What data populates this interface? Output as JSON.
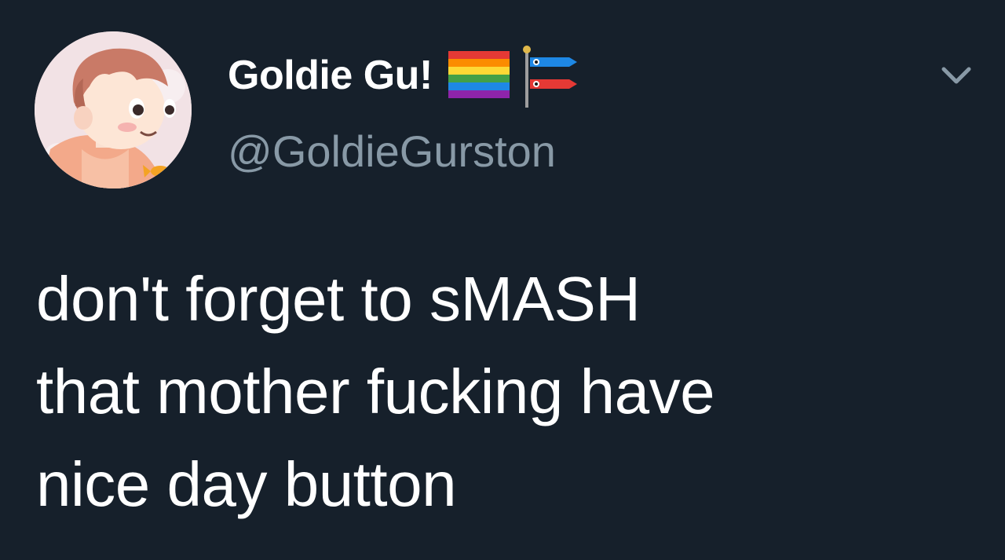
{
  "author": {
    "display_name": "Goldie Gu!",
    "handle": "@GoldieGurston",
    "avatar_icon": "cartoon-boy-avatar",
    "name_emojis": [
      "rainbow-flag-icon",
      "carp-streamer-icon"
    ]
  },
  "tweet": {
    "lines": [
      "don't forget to sMASH",
      "that mother fucking have",
      "nice day button"
    ]
  },
  "menu": {
    "icon": "chevron-down-icon"
  },
  "colors": {
    "background": "#16202b",
    "text_primary": "#ffffff",
    "text_secondary": "#8899a6"
  }
}
